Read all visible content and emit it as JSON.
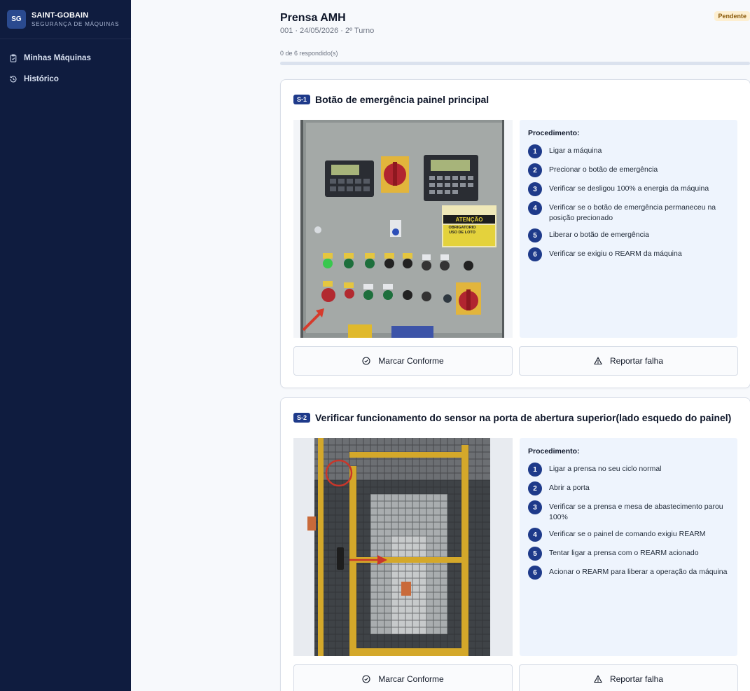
{
  "brand": {
    "logo": "SG",
    "name": "SAINT-GOBAIN",
    "tagline": "SEGURANÇA DE MÁQUINAS"
  },
  "nav": [
    {
      "label": "Minhas Máquinas",
      "icon": "clipboard-icon"
    },
    {
      "label": "Histórico",
      "icon": "history-icon"
    }
  ],
  "header": {
    "title": "Prensa AMH",
    "subtitle": "001 · 24/05/2026 · 2º Turno",
    "status": "Pendente",
    "progress_label": "0 de 6 respondido(s)",
    "progress": 0
  },
  "items": [
    {
      "tag": "S-1",
      "title": "Botão de emergência painel principal",
      "proc_title": "Procedimento:",
      "steps": [
        "Ligar a máquina",
        "Precionar o botão de emergência",
        "Verificar se desligou 100% a energia da máquina",
        "Verificar se o botão de emergência permaneceu na posição precionado",
        "Liberar o botão de emergência",
        "Verificar se exigiu o REARM da máquina"
      ],
      "photo_label": "ATENÇÃO",
      "photo_sub": "OBRIGATÓRIO USO DE LOTO",
      "conform_label": "Marcar Conforme",
      "fault_label": "Reportar falha"
    },
    {
      "tag": "S-2",
      "title": "Verificar funcionamento do sensor na porta de abertura superior(lado esquedo do painel)",
      "proc_title": "Procedimento:",
      "steps": [
        "Ligar a prensa no seu ciclo normal",
        "Abrir a porta",
        "Verificar se a prensa e mesa de abastecimento parou 100%",
        "Verificar se o painel de comando exigiu REARM",
        "Tentar ligar a prensa com o REARM acionado",
        "Acionar o REARM para liberar a operação da máquina"
      ],
      "conform_label": "Marcar Conforme",
      "fault_label": "Reportar falha"
    }
  ]
}
